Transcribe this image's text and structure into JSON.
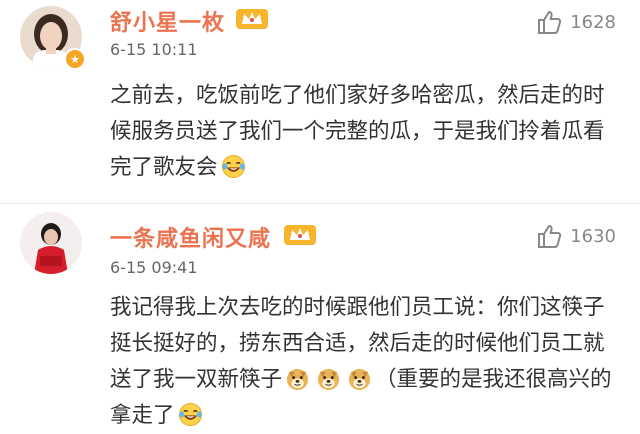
{
  "comments": [
    {
      "username": "舒小星一枚",
      "timestamp": "6-15 10:11",
      "likes": "1628",
      "text_parts": [
        "之前去，吃饭前吃了他们家好多哈密瓜，然后走的时候服务员送了我们一个完整的瓜，于是我们拎着瓜看完了歌友会"
      ],
      "emojis": [
        "laughing-tears-emoji"
      ],
      "colors": {
        "username": "#eb7350"
      }
    },
    {
      "username": "一条咸鱼闲又咸",
      "timestamp": "6-15 09:41",
      "likes": "1630",
      "text_parts": [
        "我记得我上次去吃的时候跟他们员工说：你们这筷子挺长挺好的，捞东西合适，然后走的时候他们员工就送了我一双新筷子",
        "（重要的是我还很高兴的拿走了"
      ],
      "emojis": [
        "doge-emoji",
        "doge-emoji",
        "doge-emoji",
        "laughing-tears-emoji"
      ],
      "colors": {
        "username": "#eb7350"
      }
    }
  ],
  "icons": {
    "like": "thumbs-up-icon",
    "vip": "vip-crown-icon",
    "verify": "verified-badge-icon"
  }
}
